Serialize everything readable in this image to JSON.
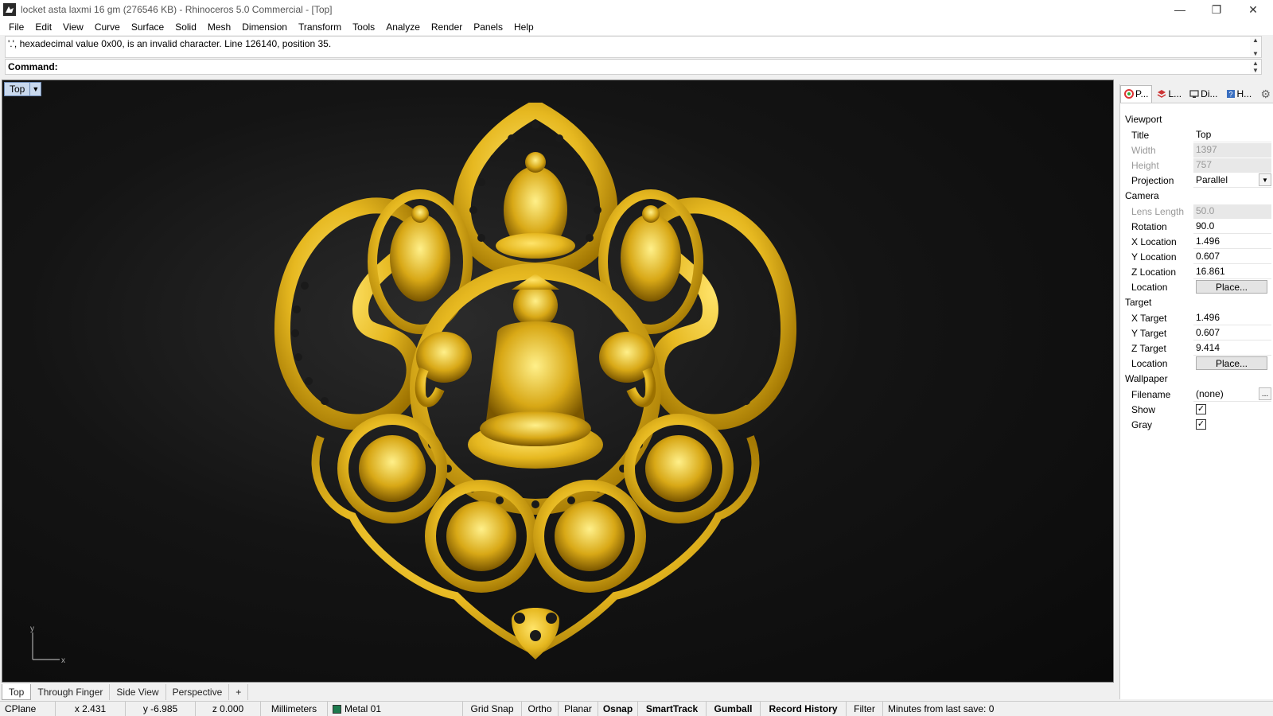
{
  "window": {
    "title": "locket asta laxmi 16 gm (276546 KB) - Rhinoceros 5.0 Commercial - [Top]",
    "minimize": "—",
    "restore": "❐",
    "close": "✕"
  },
  "menu": [
    "File",
    "Edit",
    "View",
    "Curve",
    "Surface",
    "Solid",
    "Mesh",
    "Dimension",
    "Transform",
    "Tools",
    "Analyze",
    "Render",
    "Panels",
    "Help"
  ],
  "command": {
    "history": "'.', hexadecimal value 0x00, is an invalid character. Line 126140, position 35.",
    "prompt": "Command:"
  },
  "viewport": {
    "title": "Top",
    "axis_y": "y",
    "axis_x": "x",
    "tabs": [
      "Top",
      "Through Finger",
      "Side View",
      "Perspective"
    ],
    "add_tab": "+",
    "model_color": "#e6b820"
  },
  "statusbar": {
    "cplane": "CPlane",
    "x": "x 2.431",
    "y": "y -6.985",
    "z": "z 0.000",
    "units": "Millimeters",
    "layer": "Metal 01",
    "layer_color": "#1e7a4e",
    "grid_snap": "Grid Snap",
    "ortho": "Ortho",
    "planar": "Planar",
    "osnap": "Osnap",
    "smarttrack": "SmartTrack",
    "gumball": "Gumball",
    "record_history": "Record History",
    "filter": "Filter",
    "save_info": "Minutes from last save: 0"
  },
  "panel": {
    "tabs": [
      "P...",
      "L...",
      "Di...",
      "H..."
    ],
    "sections": {
      "viewport": "Viewport",
      "camera": "Camera",
      "target": "Target",
      "wallpaper": "Wallpaper"
    },
    "viewport": {
      "title_label": "Title",
      "title_value": "Top",
      "width_label": "Width",
      "width_value": "1397",
      "height_label": "Height",
      "height_value": "757",
      "projection_label": "Projection",
      "projection_value": "Parallel"
    },
    "camera": {
      "lens_label": "Lens Length",
      "lens_value": "50.0",
      "rotation_label": "Rotation",
      "rotation_value": "90.0",
      "xloc_label": "X Location",
      "xloc_value": "1.496",
      "yloc_label": "Y Location",
      "yloc_value": "0.607",
      "zloc_label": "Z Location",
      "zloc_value": "16.861",
      "location_label": "Location",
      "place_button": "Place..."
    },
    "target": {
      "x_label": "X Target",
      "x_value": "1.496",
      "y_label": "Y Target",
      "y_value": "0.607",
      "z_label": "Z Target",
      "z_value": "9.414",
      "location_label": "Location",
      "place_button": "Place..."
    },
    "wallpaper": {
      "filename_label": "Filename",
      "filename_value": "(none)",
      "browse": "...",
      "show_label": "Show",
      "show_checked": "✓",
      "gray_label": "Gray",
      "gray_checked": "✓"
    }
  }
}
